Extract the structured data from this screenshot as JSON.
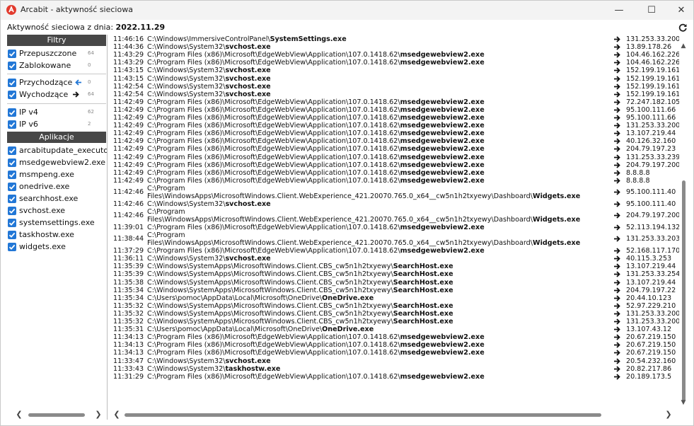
{
  "window": {
    "title": "Arcabit - aktywność sieciowa",
    "min": "—",
    "max": "☐",
    "close": "✕"
  },
  "header": {
    "label": "Aktywność sieciowa z dnia:",
    "date": "2022.11.29"
  },
  "sidebar": {
    "filters_head": "Filtry",
    "filters": [
      {
        "label": "Przepuszczone",
        "count": "64"
      },
      {
        "label": "Zablokowane",
        "count": "0"
      },
      {
        "label": "Przychodzące",
        "count": "0"
      },
      {
        "label": "Wychodzące",
        "count": "64"
      },
      {
        "label": "IP v4",
        "count": "62"
      },
      {
        "label": "IP v6",
        "count": "2"
      }
    ],
    "apps_head": "Aplikacje",
    "apps": [
      "arcabitupdate_executo",
      "msedgewebview2.exe",
      "msmpeng.exe",
      "onedrive.exe",
      "searchhost.exe",
      "svchost.exe",
      "systemsettings.exe",
      "taskhostw.exe",
      "widgets.exe"
    ]
  },
  "log": [
    {
      "time": "11:46:16",
      "dir": "C:\\Windows\\ImmersiveControlPanel\\",
      "exe": "SystemSettings.exe",
      "ip": "131.253.33.200"
    },
    {
      "time": "11:44:36",
      "dir": "C:\\Windows\\System32\\",
      "exe": "svchost.exe",
      "ip": "13.89.178.26"
    },
    {
      "time": "11:43:29",
      "dir": "C:\\Program Files (x86)\\Microsoft\\EdgeWebView\\Application\\107.0.1418.62\\",
      "exe": "msedgewebview2.exe",
      "ip": "104.46.162.226"
    },
    {
      "time": "11:43:29",
      "dir": "C:\\Program Files (x86)\\Microsoft\\EdgeWebView\\Application\\107.0.1418.62\\",
      "exe": "msedgewebview2.exe",
      "ip": "104.46.162.226"
    },
    {
      "time": "11:43:15",
      "dir": "C:\\Windows\\System32\\",
      "exe": "svchost.exe",
      "ip": "152.199.19.161"
    },
    {
      "time": "11:43:15",
      "dir": "C:\\Windows\\System32\\",
      "exe": "svchost.exe",
      "ip": "152.199.19.161"
    },
    {
      "time": "11:42:54",
      "dir": "C:\\Windows\\System32\\",
      "exe": "svchost.exe",
      "ip": "152.199.19.161"
    },
    {
      "time": "11:42:54",
      "dir": "C:\\Windows\\System32\\",
      "exe": "svchost.exe",
      "ip": "152.199.19.161"
    },
    {
      "time": "11:42:49",
      "dir": "C:\\Program Files (x86)\\Microsoft\\EdgeWebView\\Application\\107.0.1418.62\\",
      "exe": "msedgewebview2.exe",
      "ip": "72.247.182.105"
    },
    {
      "time": "11:42:49",
      "dir": "C:\\Program Files (x86)\\Microsoft\\EdgeWebView\\Application\\107.0.1418.62\\",
      "exe": "msedgewebview2.exe",
      "ip": "95.100.111.66"
    },
    {
      "time": "11:42:49",
      "dir": "C:\\Program Files (x86)\\Microsoft\\EdgeWebView\\Application\\107.0.1418.62\\",
      "exe": "msedgewebview2.exe",
      "ip": "95.100.111.66"
    },
    {
      "time": "11:42:49",
      "dir": "C:\\Program Files (x86)\\Microsoft\\EdgeWebView\\Application\\107.0.1418.62\\",
      "exe": "msedgewebview2.exe",
      "ip": "131.253.33.200"
    },
    {
      "time": "11:42:49",
      "dir": "C:\\Program Files (x86)\\Microsoft\\EdgeWebView\\Application\\107.0.1418.62\\",
      "exe": "msedgewebview2.exe",
      "ip": "13.107.219.44"
    },
    {
      "time": "11:42:49",
      "dir": "C:\\Program Files (x86)\\Microsoft\\EdgeWebView\\Application\\107.0.1418.62\\",
      "exe": "msedgewebview2.exe",
      "ip": "40.126.32.160"
    },
    {
      "time": "11:42:49",
      "dir": "C:\\Program Files (x86)\\Microsoft\\EdgeWebView\\Application\\107.0.1418.62\\",
      "exe": "msedgewebview2.exe",
      "ip": "204.79.197.23"
    },
    {
      "time": "11:42:49",
      "dir": "C:\\Program Files (x86)\\Microsoft\\EdgeWebView\\Application\\107.0.1418.62\\",
      "exe": "msedgewebview2.exe",
      "ip": "131.253.33.239"
    },
    {
      "time": "11:42:49",
      "dir": "C:\\Program Files (x86)\\Microsoft\\EdgeWebView\\Application\\107.0.1418.62\\",
      "exe": "msedgewebview2.exe",
      "ip": "204.79.197.200"
    },
    {
      "time": "11:42:49",
      "dir": "C:\\Program Files (x86)\\Microsoft\\EdgeWebView\\Application\\107.0.1418.62\\",
      "exe": "msedgewebview2.exe",
      "ip": "8.8.8.8"
    },
    {
      "time": "11:42:49",
      "dir": "C:\\Program Files (x86)\\Microsoft\\EdgeWebView\\Application\\107.0.1418.62\\",
      "exe": "msedgewebview2.exe",
      "ip": "8.8.8.8"
    },
    {
      "time": "11:42:46",
      "dir": "C:\\Program Files\\WindowsApps\\MicrosoftWindows.Client.WebExperience_421.20070.765.0_x64__cw5n1h2txyewy\\Dashboard\\",
      "exe": "Widgets.exe",
      "ip": "95.100.111.40",
      "tall": true
    },
    {
      "time": "11:42:46",
      "dir": "C:\\Windows\\System32\\",
      "exe": "svchost.exe",
      "ip": "95.100.111.40"
    },
    {
      "time": "11:42:46",
      "dir": "C:\\Program Files\\WindowsApps\\MicrosoftWindows.Client.WebExperience_421.20070.765.0_x64__cw5n1h2txyewy\\Dashboard\\",
      "exe": "Widgets.exe",
      "ip": "204.79.197.200",
      "tall": true
    },
    {
      "time": "11:39:01",
      "dir": "C:\\Program Files (x86)\\Microsoft\\EdgeWebView\\Application\\107.0.1418.62\\",
      "exe": "msedgewebview2.exe",
      "ip": "52.113.194.132"
    },
    {
      "time": "11:38:44",
      "dir": "C:\\Program Files\\WindowsApps\\MicrosoftWindows.Client.WebExperience_421.20070.765.0_x64__cw5n1h2txyewy\\Dashboard\\",
      "exe": "Widgets.exe",
      "ip": "131.253.33.203",
      "tall": true
    },
    {
      "time": "11:37:29",
      "dir": "C:\\Program Files (x86)\\Microsoft\\EdgeWebView\\Application\\107.0.1418.62\\",
      "exe": "msedgewebview2.exe",
      "ip": "52.168.117.170"
    },
    {
      "time": "11:36:11",
      "dir": "C:\\Windows\\System32\\",
      "exe": "svchost.exe",
      "ip": "40.115.3.253"
    },
    {
      "time": "11:35:39",
      "dir": "C:\\Windows\\SystemApps\\MicrosoftWindows.Client.CBS_cw5n1h2txyewy\\",
      "exe": "SearchHost.exe",
      "ip": "13.107.219.44"
    },
    {
      "time": "11:35:39",
      "dir": "C:\\Windows\\SystemApps\\MicrosoftWindows.Client.CBS_cw5n1h2txyewy\\",
      "exe": "SearchHost.exe",
      "ip": "131.253.33.254"
    },
    {
      "time": "11:35:38",
      "dir": "C:\\Windows\\SystemApps\\MicrosoftWindows.Client.CBS_cw5n1h2txyewy\\",
      "exe": "SearchHost.exe",
      "ip": "13.107.219.44"
    },
    {
      "time": "11:35:34",
      "dir": "C:\\Windows\\SystemApps\\MicrosoftWindows.Client.CBS_cw5n1h2txyewy\\",
      "exe": "SearchHost.exe",
      "ip": "204.79.197.22"
    },
    {
      "time": "11:35:34",
      "dir": "C:\\Users\\pomoc\\AppData\\Local\\Microsoft\\OneDrive\\",
      "exe": "OneDrive.exe",
      "ip": "20.44.10.123"
    },
    {
      "time": "11:35:32",
      "dir": "C:\\Windows\\SystemApps\\MicrosoftWindows.Client.CBS_cw5n1h2txyewy\\",
      "exe": "SearchHost.exe",
      "ip": "52.97.229.210"
    },
    {
      "time": "11:35:32",
      "dir": "C:\\Windows\\SystemApps\\MicrosoftWindows.Client.CBS_cw5n1h2txyewy\\",
      "exe": "SearchHost.exe",
      "ip": "131.253.33.200"
    },
    {
      "time": "11:35:32",
      "dir": "C:\\Windows\\SystemApps\\MicrosoftWindows.Client.CBS_cw5n1h2txyewy\\",
      "exe": "SearchHost.exe",
      "ip": "131.253.33.200"
    },
    {
      "time": "11:35:31",
      "dir": "C:\\Users\\pomoc\\AppData\\Local\\Microsoft\\OneDrive\\",
      "exe": "OneDrive.exe",
      "ip": "13.107.43.12"
    },
    {
      "time": "11:34:13",
      "dir": "C:\\Program Files (x86)\\Microsoft\\EdgeWebView\\Application\\107.0.1418.62\\",
      "exe": "msedgewebview2.exe",
      "ip": "20.67.219.150"
    },
    {
      "time": "11:34:13",
      "dir": "C:\\Program Files (x86)\\Microsoft\\EdgeWebView\\Application\\107.0.1418.62\\",
      "exe": "msedgewebview2.exe",
      "ip": "20.67.219.150"
    },
    {
      "time": "11:34:13",
      "dir": "C:\\Program Files (x86)\\Microsoft\\EdgeWebView\\Application\\107.0.1418.62\\",
      "exe": "msedgewebview2.exe",
      "ip": "20.67.219.150"
    },
    {
      "time": "11:33:47",
      "dir": "C:\\Windows\\System32\\",
      "exe": "svchost.exe",
      "ip": "20.54.232.160"
    },
    {
      "time": "11:33:43",
      "dir": "C:\\Windows\\System32\\",
      "exe": "taskhostw.exe",
      "ip": "20.82.217.86"
    },
    {
      "time": "11:31:29",
      "dir": "C:\\Program Files (x86)\\Microsoft\\EdgeWebView\\Application\\107.0.1418.62\\",
      "exe": "msedgewebview2.exe",
      "ip": "20.189.173.5"
    }
  ],
  "colors": {
    "checkbox": "#2277d6",
    "section_head": "#474747",
    "app_icon": "#e23b2e"
  },
  "icons": {
    "app": "arcabit-logo-icon",
    "refresh": "refresh-icon",
    "incoming": "arrow-left-icon",
    "outgoing": "arrow-right-icon",
    "checkbox": "checkmark-icon"
  }
}
